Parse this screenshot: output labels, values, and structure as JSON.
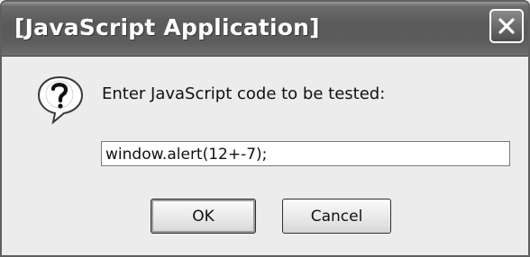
{
  "window": {
    "title": "[JavaScript Application]"
  },
  "titlebar": {
    "close_icon": "close-icon"
  },
  "dialog": {
    "icon": "question-icon",
    "prompt": "Enter JavaScript code to be tested:",
    "input_value": "window.alert(12+-7);"
  },
  "buttons": {
    "ok_label": "OK",
    "cancel_label": "Cancel"
  }
}
